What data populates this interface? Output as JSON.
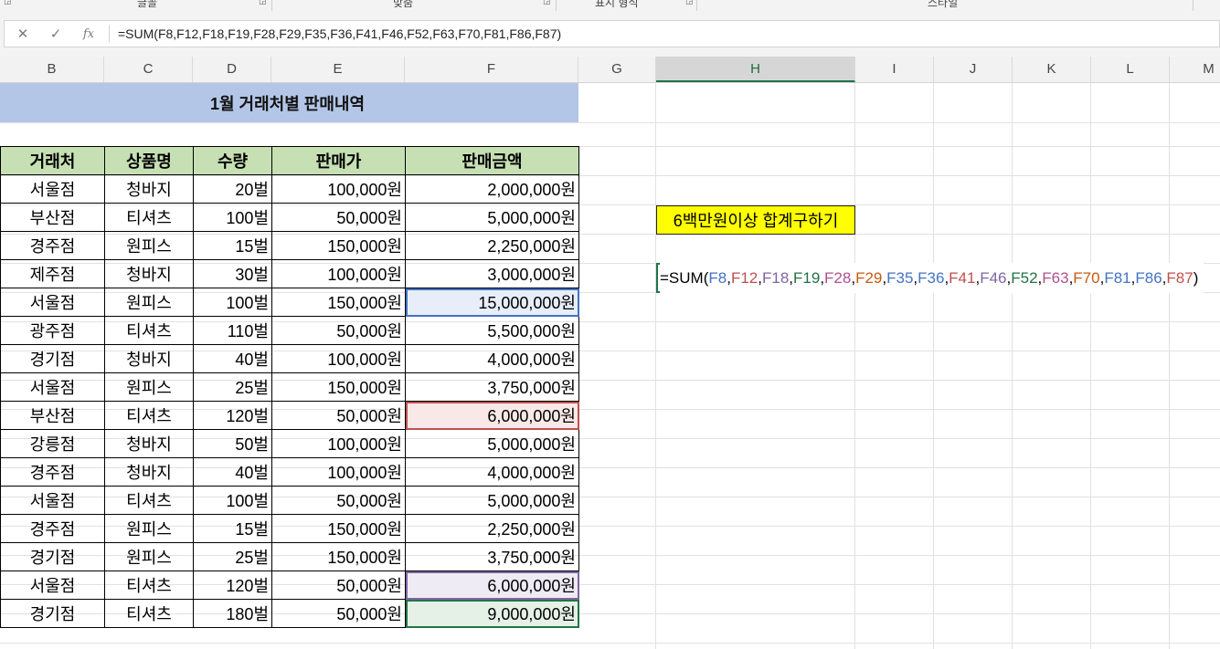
{
  "ribbon": {
    "groups": [
      "글꼴",
      "맞춤",
      "표시 형식",
      "스타일"
    ]
  },
  "formula_bar": {
    "cancel_icon": "close-icon",
    "enter_icon": "check-icon",
    "fx_label": "fx",
    "formula": "=SUM(F8,F12,F18,F19,F28,F29,F35,F36,F41,F46,F52,F63,F70,F81,F86,F87)"
  },
  "columns": [
    "B",
    "C",
    "D",
    "E",
    "F",
    "G",
    "H",
    "I",
    "J",
    "K",
    "L",
    "M"
  ],
  "selected_column": "H",
  "sheet": {
    "title": "1월 거래처별 판매내역",
    "headers": [
      "거래처",
      "상품명",
      "수량",
      "판매가",
      "판매금액"
    ],
    "rows": [
      {
        "client": "서울점",
        "product": "청바지",
        "qty": "20벌",
        "price": "100,000원",
        "amount": "2,000,000원",
        "highlight": ""
      },
      {
        "client": "부산점",
        "product": "티셔츠",
        "qty": "100벌",
        "price": "50,000원",
        "amount": "5,000,000원",
        "highlight": ""
      },
      {
        "client": "경주점",
        "product": "원피스",
        "qty": "15벌",
        "price": "150,000원",
        "amount": "2,250,000원",
        "highlight": ""
      },
      {
        "client": "제주점",
        "product": "청바지",
        "qty": "30벌",
        "price": "100,000원",
        "amount": "3,000,000원",
        "highlight": ""
      },
      {
        "client": "서울점",
        "product": "원피스",
        "qty": "100벌",
        "price": "150,000원",
        "amount": "15,000,000원",
        "highlight": "blue"
      },
      {
        "client": "광주점",
        "product": "티셔츠",
        "qty": "110벌",
        "price": "50,000원",
        "amount": "5,500,000원",
        "highlight": ""
      },
      {
        "client": "경기점",
        "product": "청바지",
        "qty": "40벌",
        "price": "100,000원",
        "amount": "4,000,000원",
        "highlight": ""
      },
      {
        "client": "서울점",
        "product": "원피스",
        "qty": "25벌",
        "price": "150,000원",
        "amount": "3,750,000원",
        "highlight": ""
      },
      {
        "client": "부산점",
        "product": "티셔츠",
        "qty": "120벌",
        "price": "50,000원",
        "amount": "6,000,000원",
        "highlight": "red"
      },
      {
        "client": "강릉점",
        "product": "청바지",
        "qty": "50벌",
        "price": "100,000원",
        "amount": "5,000,000원",
        "highlight": ""
      },
      {
        "client": "경주점",
        "product": "청바지",
        "qty": "40벌",
        "price": "100,000원",
        "amount": "4,000,000원",
        "highlight": ""
      },
      {
        "client": "서울점",
        "product": "티셔츠",
        "qty": "100벌",
        "price": "50,000원",
        "amount": "5,000,000원",
        "highlight": ""
      },
      {
        "client": "경주점",
        "product": "원피스",
        "qty": "15벌",
        "price": "150,000원",
        "amount": "2,250,000원",
        "highlight": ""
      },
      {
        "client": "경기점",
        "product": "원피스",
        "qty": "25벌",
        "price": "150,000원",
        "amount": "3,750,000원",
        "highlight": ""
      },
      {
        "client": "서울점",
        "product": "티셔츠",
        "qty": "120벌",
        "price": "50,000원",
        "amount": "6,000,000원",
        "highlight": "purple"
      },
      {
        "client": "경기점",
        "product": "티셔츠",
        "qty": "180벌",
        "price": "50,000원",
        "amount": "9,000,000원",
        "highlight": "green"
      }
    ]
  },
  "note": "6백만원이상 합계구하기",
  "edit_cell": {
    "prefix": "=SUM(",
    "refs": [
      {
        "ref": "F8",
        "color": "#4472c4"
      },
      {
        "ref": "F12",
        "color": "#c0504d"
      },
      {
        "ref": "F18",
        "color": "#8064a2"
      },
      {
        "ref": "F19",
        "color": "#217346"
      },
      {
        "ref": "F28",
        "color": "#b0508f"
      },
      {
        "ref": "F29",
        "color": "#c55a11"
      },
      {
        "ref": "F35",
        "color": "#4472c4"
      },
      {
        "ref": "F36",
        "color": "#4472c4"
      },
      {
        "ref": "F41",
        "color": "#c0504d"
      },
      {
        "ref": "F46",
        "color": "#8064a2"
      },
      {
        "ref": "F52",
        "color": "#217346"
      },
      {
        "ref": "F63",
        "color": "#b0508f"
      },
      {
        "ref": "F70",
        "color": "#c55a11"
      },
      {
        "ref": "F81",
        "color": "#4472c4"
      },
      {
        "ref": "F86",
        "color": "#4472c4"
      },
      {
        "ref": "F87",
        "color": "#c0504d"
      }
    ],
    "suffix": ")",
    "comma": ","
  }
}
